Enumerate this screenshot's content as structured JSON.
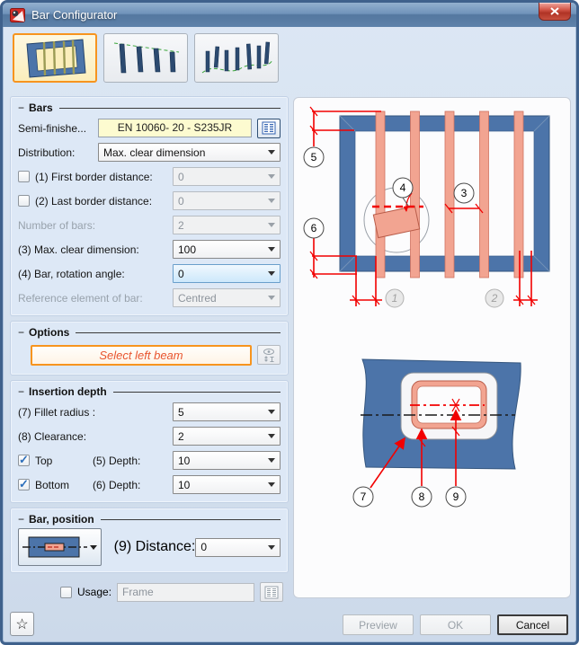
{
  "window": {
    "title": "Bar Configurator"
  },
  "bars": {
    "title": "Bars",
    "semi_finished_label": "Semi-finishe...",
    "semi_finished_value": "EN 10060- 20 - S235JR",
    "distribution_label": "Distribution:",
    "distribution_value": "Max. clear dimension",
    "first_border_label": "(1) First border distance:",
    "first_border_value": "0",
    "last_border_label": "(2) Last border distance:",
    "last_border_value": "0",
    "number_label": "Number of bars:",
    "number_value": "2",
    "max_clear_label": "(3) Max. clear dimension:",
    "max_clear_value": "100",
    "rotation_label": "(4) Bar, rotation angle:",
    "rotation_value": "0",
    "reference_label": "Reference element of bar:",
    "reference_value": "Centred"
  },
  "options": {
    "title": "Options",
    "select_beam_label": "Select left beam"
  },
  "insertion": {
    "title": "Insertion depth",
    "fillet_label": "(7) Fillet radius :",
    "fillet_value": "5",
    "clearance_label": "(8) Clearance:",
    "clearance_value": "2",
    "top_label": "Top",
    "top_depth_label": "(5) Depth:",
    "top_depth_value": "10",
    "bottom_label": "Bottom",
    "bottom_depth_label": "(6) Depth:",
    "bottom_depth_value": "10"
  },
  "position": {
    "title": "Bar, position",
    "distance_label": "(9) Distance:",
    "distance_value": "0"
  },
  "usage": {
    "label": "Usage:",
    "value": "Frame"
  },
  "footer": {
    "preview_label": "Preview",
    "ok_label": "OK",
    "cancel_label": "Cancel"
  },
  "diagram": {
    "c1": "1",
    "c2": "2",
    "c3": "3",
    "c4": "4",
    "c5": "5",
    "c6": "6",
    "c7": "7",
    "c8": "8",
    "c9": "9"
  },
  "colors": {
    "accent_orange": "#F7941E",
    "frame_blue": "#4C74A9",
    "bar_salmon": "#F2A491",
    "dimension_red": "#F20000",
    "field_yellow": "#FDFBD0"
  }
}
